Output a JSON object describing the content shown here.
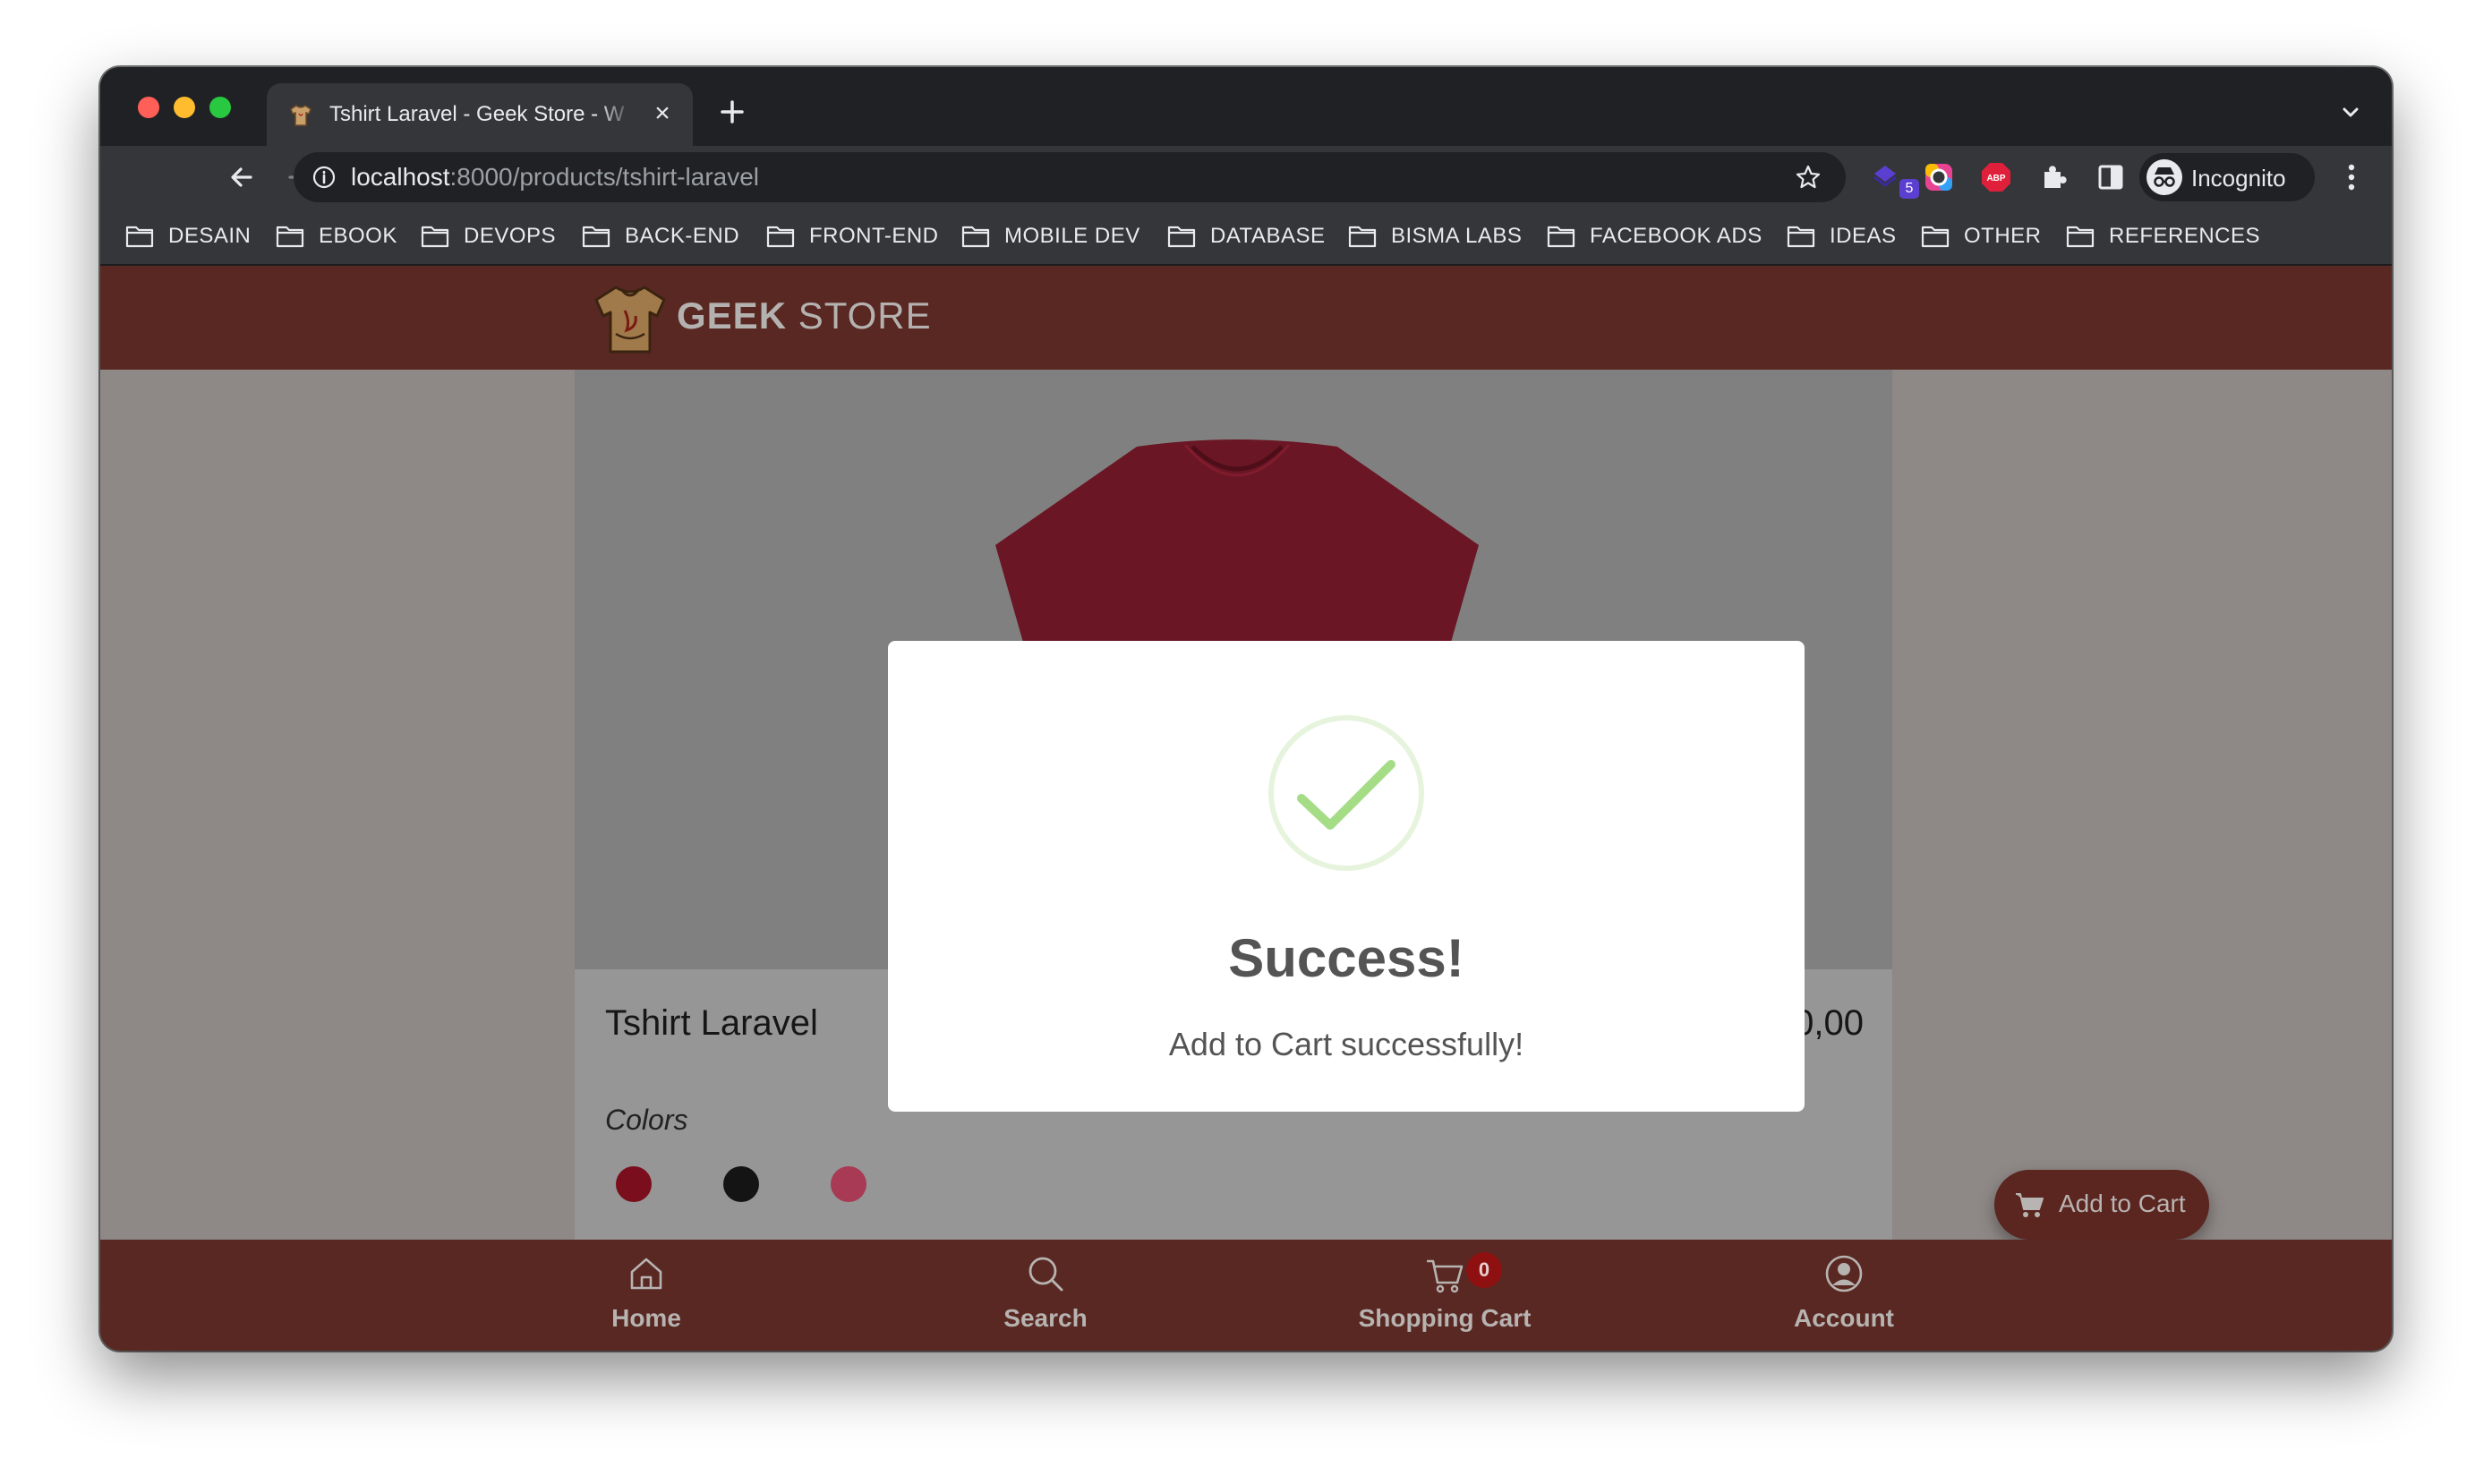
{
  "browser": {
    "tab_title": "Tshirt Laravel - Geek Store - W",
    "url_host": "localhost",
    "url_path": ":8000/products/tshirt-laravel",
    "extension_badge": "5",
    "profile_label": "Incognito",
    "bookmarks": [
      "DESAIN",
      "EBOOK",
      "DEVOPS",
      "BACK-END",
      "FRONT-END",
      "MOBILE DEV",
      "DATABASE",
      "BISMA LABS",
      "FACEBOOK ADS",
      "IDEAS",
      "OTHER",
      "REFERENCES"
    ]
  },
  "site": {
    "logo_bold": "GEEK",
    "logo_rest": " STORE"
  },
  "product": {
    "name": "Tshirt Laravel",
    "price": "85.000,00",
    "colors_label": "Colors",
    "colors": [
      "#7a0e1c",
      "#141414",
      "#a83a55"
    ],
    "shirt_color": "#6a1624",
    "add_to_cart_label": "Add to Cart"
  },
  "bottom_nav": {
    "items": [
      {
        "label": "Home",
        "icon": "home-icon"
      },
      {
        "label": "Search",
        "icon": "search-icon"
      },
      {
        "label": "Shopping Cart",
        "icon": "cart-icon"
      },
      {
        "label": "Account",
        "icon": "account-icon"
      }
    ],
    "cart_count": "0"
  },
  "modal": {
    "icon": "success-check-icon",
    "title": "Success!",
    "message": "Add to Cart successfully!"
  },
  "colors": {
    "header_bg": "#592822",
    "success_green": "#a5dc86",
    "cart_badge": "#8e1010"
  }
}
